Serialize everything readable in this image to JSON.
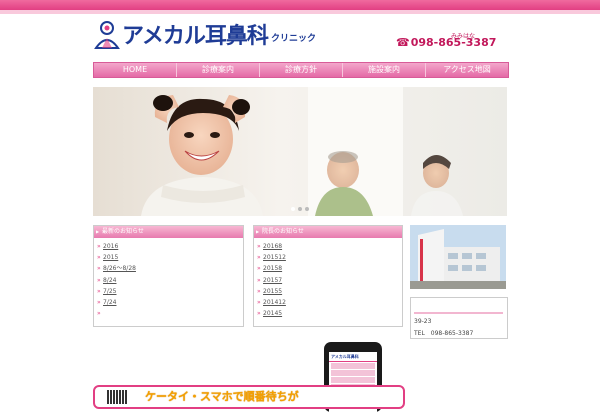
{
  "header": {
    "logo_main": "アメカル耳鼻科",
    "logo_sub": "クリニック",
    "phone_ruby": "みみはな",
    "phone_number": "098-865-3387"
  },
  "nav": {
    "items": [
      {
        "label": "HOME"
      },
      {
        "label": "診療案内"
      },
      {
        "label": "診療方針"
      },
      {
        "label": "施設案内"
      },
      {
        "label": "アクセス地図"
      }
    ]
  },
  "slider": {
    "slide_count": 3,
    "active_index": 0
  },
  "news_box_1": {
    "heading": "最新のお知らせ",
    "items": [
      {
        "text": "2016"
      },
      {
        "text": "2015"
      },
      {
        "text": "8/26～8/28"
      },
      {
        "text": "8/24"
      },
      {
        "text": "7/25"
      },
      {
        "text": "7/24"
      },
      {
        "text": ""
      }
    ]
  },
  "news_box_2": {
    "heading": "院長のお知らせ",
    "items": [
      {
        "text": "20168"
      },
      {
        "text": "201512"
      },
      {
        "text": "20158"
      },
      {
        "text": "20157"
      },
      {
        "text": "20155"
      },
      {
        "text": "201412"
      },
      {
        "text": "20145"
      }
    ]
  },
  "clinic_info": {
    "address": "39-23",
    "tel": "TEL　098-865-3387"
  },
  "promo": {
    "text": "ケータイ・スマホで順番待ちが",
    "phone_app_title": "アメカル耳鼻科"
  },
  "colors": {
    "accent": "#e23f83",
    "brand_blue": "#1f3c96",
    "nav_pink": "#e46aa6",
    "promo_orange": "#f4a000"
  }
}
